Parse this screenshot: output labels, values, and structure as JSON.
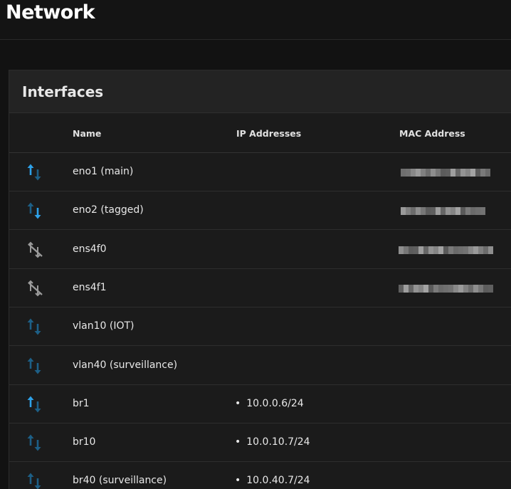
{
  "page": {
    "title": "Network"
  },
  "interfaces": {
    "title": "Interfaces",
    "columns": {
      "name": "Name",
      "ip": "IP Addresses",
      "mac": "MAC Address"
    },
    "rows": [
      {
        "name": "eno1 (main)",
        "ip": "",
        "status": "up-active",
        "mac": "redacted"
      },
      {
        "name": "eno2 (tagged)",
        "ip": "",
        "status": "down-active",
        "mac": "redacted"
      },
      {
        "name": "ens4f0",
        "ip": "",
        "status": "disconnected",
        "mac": "redacted"
      },
      {
        "name": "ens4f1",
        "ip": "",
        "status": "disconnected",
        "mac": "redacted"
      },
      {
        "name": "vlan10 (IOT)",
        "ip": "",
        "status": "idle",
        "mac": ""
      },
      {
        "name": "vlan40 (surveillance)",
        "ip": "",
        "status": "idle",
        "mac": ""
      },
      {
        "name": "br1",
        "ip": "10.0.0.6/24",
        "status": "up-active",
        "mac": ""
      },
      {
        "name": "br10",
        "ip": "10.0.10.7/24",
        "status": "idle",
        "mac": ""
      },
      {
        "name": "br40 (surveillance)",
        "ip": "10.0.40.7/24",
        "status": "idle",
        "mac": ""
      }
    ]
  },
  "colors": {
    "bright_arrow": "#2ea1e8",
    "dim_arrow": "#1d5f86",
    "disconnected": "#9a9a9a"
  }
}
